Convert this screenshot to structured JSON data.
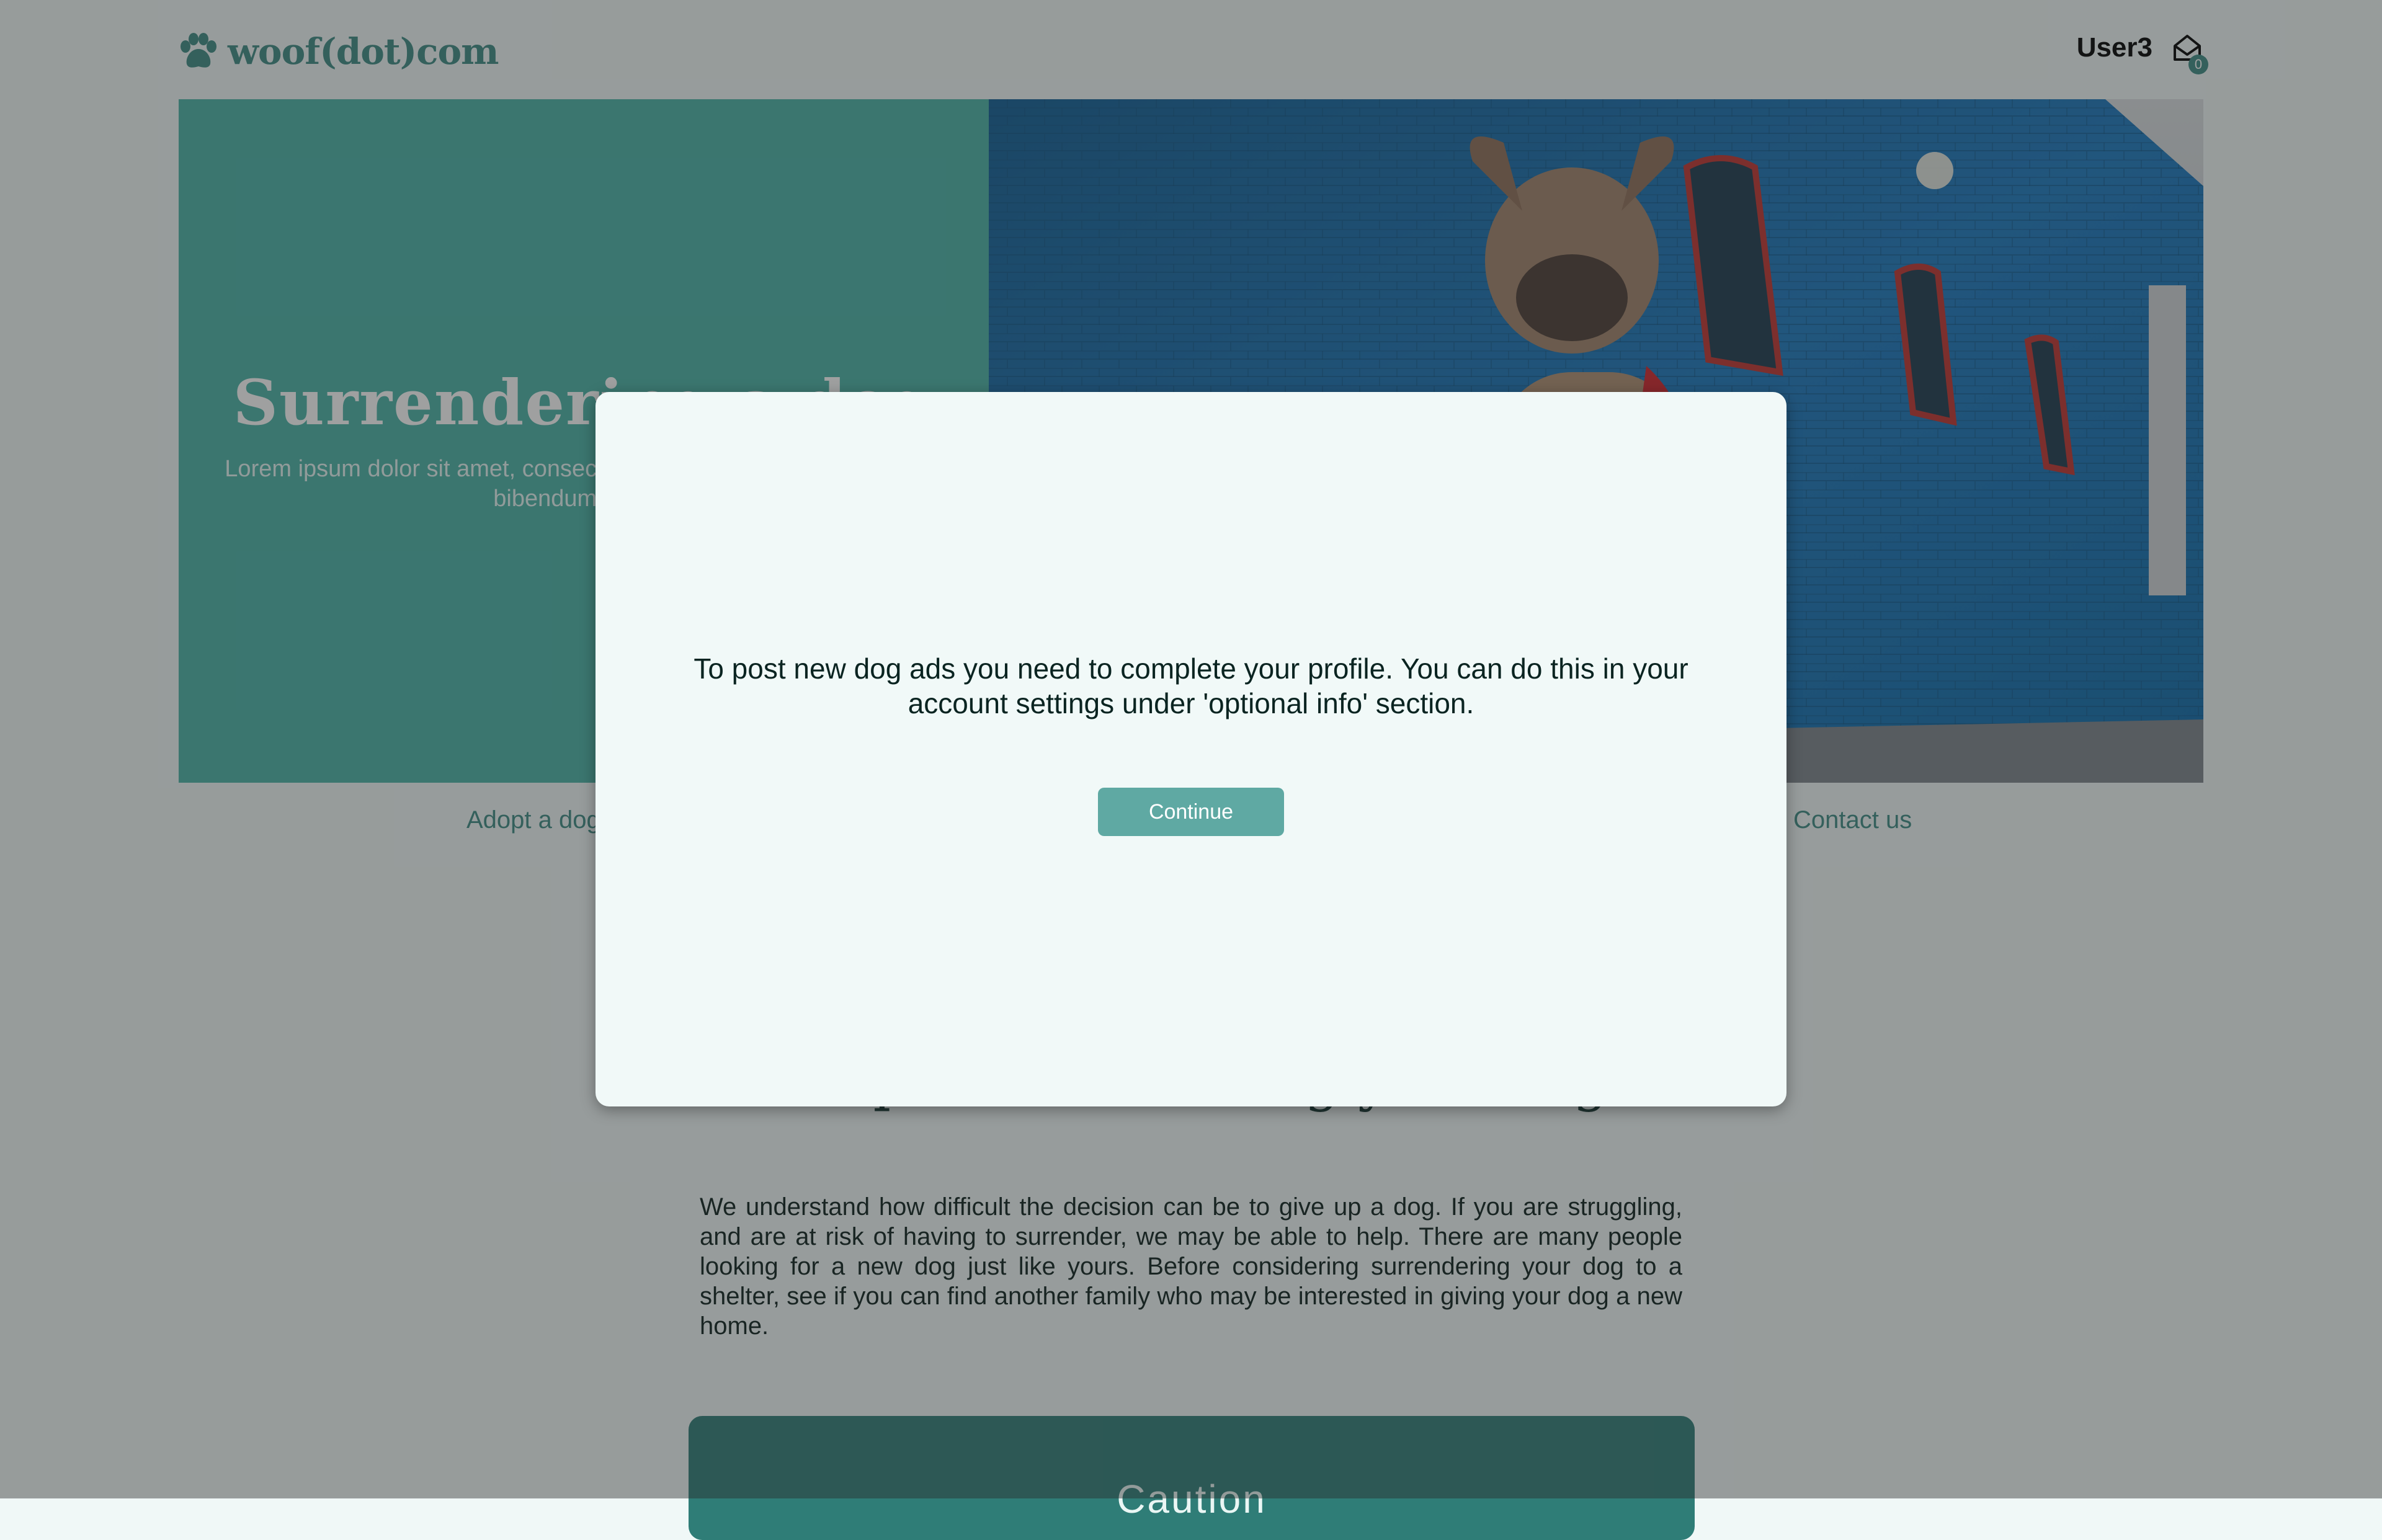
{
  "header": {
    "logo_text": "woof(dot)com",
    "user_name": "User3",
    "mail_count": "0"
  },
  "hero": {
    "title": "Surrendering a dog",
    "subtitle": "Lorem ipsum dolor sit amet, consectetur adipiscing elit. Aenean vitae bibendum ex nec",
    "image": "french-bulldog-blue-wall-photo"
  },
  "nav": {
    "adopt_label": "Adopt a dog",
    "contact_label": "Contact us"
  },
  "section": {
    "heading": "Help with rehoming your dog",
    "text": "We understand how difficult the decision can be to give up a dog. If you are struggling, and are at risk of having to surrender, we may be able to help. There are many people looking for a new dog just like yours. Before considering surrendering your dog to a shelter, see if you can find another family who may be interested in giving your dog a new home.",
    "caution_title": "Caution"
  },
  "modal": {
    "message": "To post new dog ads you need to complete your profile. You can do this in your account settings under 'optional info' section.",
    "continue_label": "Continue"
  },
  "colors": {
    "brand": "#3d8a84",
    "hero_panel": "#49b2a7",
    "button": "#5fa9a3",
    "modal_bg": "#f1f9f8"
  },
  "icons": [
    "paw-icon",
    "mail-icon"
  ]
}
